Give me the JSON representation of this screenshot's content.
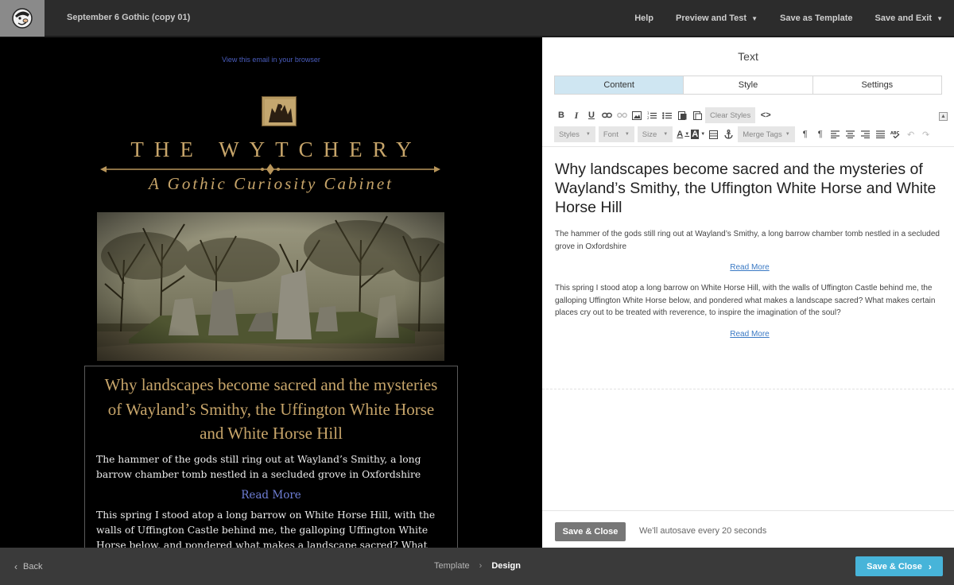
{
  "topbar": {
    "doc_title": "September 6 Gothic (copy 01)",
    "links": {
      "help": "Help",
      "preview": "Preview and Test",
      "save_template": "Save as Template",
      "save_exit": "Save and Exit"
    }
  },
  "preview": {
    "browser_link": "View this email in your browser",
    "brand_title": "THE WYTCHERY",
    "brand_subtitle": "A Gothic Curiosity Cabinet",
    "article": {
      "heading": "Why landscapes become sacred and the mysteries of Wayland’s Smithy, the Uffington White Horse and White Horse Hill",
      "para1": "The hammer of the gods still ring out at Wayland’s Smithy, a long barrow chamber tomb nestled in a secluded grove in Oxfordshire",
      "read_more": "Read More",
      "para2": "This spring I stood atop a long barrow on White Horse Hill, with the walls of Uffington Castle behind me, the galloping Uffington White Horse below, and pondered what makes a landscape sacred?  What makes certain"
    }
  },
  "editor": {
    "title": "Text",
    "tabs": [
      "Content",
      "Style",
      "Settings"
    ],
    "toolbar": {
      "bold": "B",
      "italic": "I",
      "underline": "U",
      "clear_styles": "Clear Styles",
      "source": "<>",
      "styles": "Styles",
      "font": "Font",
      "size": "Size",
      "font_color": "A",
      "bg_color": "A",
      "merge_tags": "Merge Tags"
    },
    "content": {
      "heading": "Why landscapes become sacred and the mysteries of Wayland’s Smithy, the Uffington White Horse and White Horse Hill",
      "para1": "The hammer of the gods still ring out at Wayland’s Smithy, a long barrow chamber tomb nestled in a secluded grove in Oxfordshire",
      "read_more_1": "Read More",
      "para2": "This spring I stood atop a long barrow on White Horse Hill, with the walls of Uffington Castle behind me, the galloping Uffington White Horse below, and pondered what makes a landscape sacred?  What makes certain places cry out to be treated with reverence, to inspire the imagination of the soul?",
      "read_more_2": "Read More"
    },
    "footer": {
      "save_close": "Save & Close",
      "autosave": "We'll autosave every 20 seconds"
    }
  },
  "bottombar": {
    "back": "Back",
    "crumbs": [
      "Template",
      "Design"
    ],
    "save_close": "Save & Close"
  },
  "colors": {
    "accent": "#47b4d9",
    "gold": "#c7a56a",
    "link": "#3a79c4",
    "tab_active": "#cfe6f2"
  }
}
